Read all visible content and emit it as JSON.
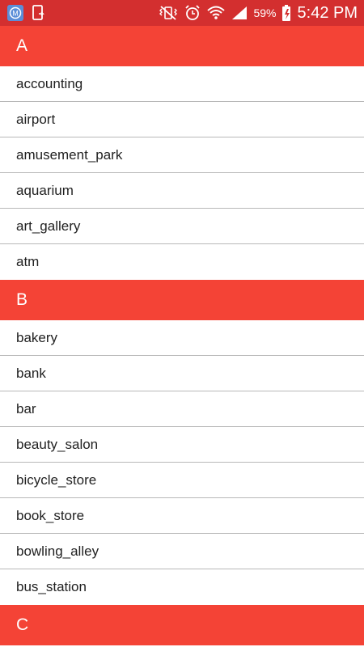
{
  "status_bar": {
    "battery_percent": "59%",
    "time": "5:42 PM",
    "left_icons": [
      "app-notification-icon",
      "phone-notification-icon"
    ],
    "right_icons": [
      "vibrate-mute-icon",
      "alarm-icon",
      "wifi-icon",
      "signal-icon",
      "battery-charging-icon"
    ]
  },
  "colors": {
    "status_bar": "#d32f2f",
    "section_header": "#f44336",
    "row_text": "#212121",
    "divider": "#b8b8b8"
  },
  "sections": [
    {
      "letter": "A",
      "items": [
        "accounting",
        "airport",
        "amusement_park",
        "aquarium",
        "art_gallery",
        "atm"
      ]
    },
    {
      "letter": "B",
      "items": [
        "bakery",
        "bank",
        "bar",
        "beauty_salon",
        "bicycle_store",
        "book_store",
        "bowling_alley",
        "bus_station"
      ]
    },
    {
      "letter": "C",
      "items": []
    }
  ]
}
